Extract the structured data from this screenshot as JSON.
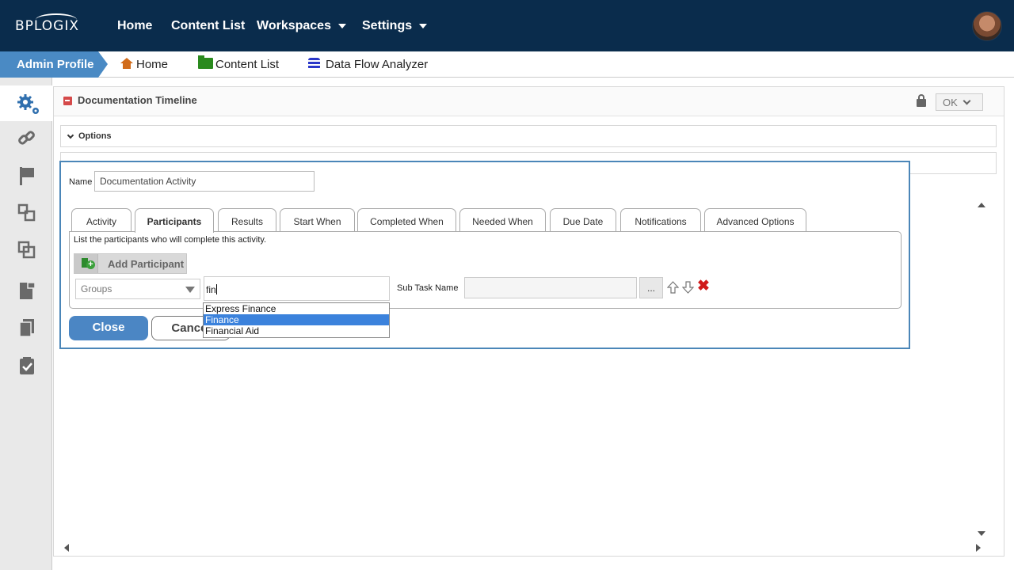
{
  "topbar": {
    "logo": "BPLOGIX",
    "nav": [
      {
        "label": "Home"
      },
      {
        "label": "Content List"
      },
      {
        "label": "Workspaces"
      },
      {
        "label": "Settings"
      }
    ]
  },
  "secondary_bar": {
    "profile": "Admin Profile",
    "links": [
      {
        "label": "Home",
        "icon": "home-icon"
      },
      {
        "label": "Content List",
        "icon": "folder-icon"
      },
      {
        "label": "Data Flow Analyzer",
        "icon": "database-icon"
      }
    ]
  },
  "sidebar": {
    "items": [
      "settings-gears-icon",
      "link-icon",
      "flag-icon",
      "subprocess-icon",
      "copy-frames-icon",
      "locked-document-icon",
      "documents-icon",
      "task-check-icon"
    ]
  },
  "main": {
    "title": "Documentation Timeline",
    "ok_label": "OK",
    "options_label": "Options"
  },
  "dialog": {
    "name_label": "Name",
    "name_value": "Documentation Activity",
    "tabs": [
      {
        "label": "Activity"
      },
      {
        "label": "Participants",
        "active": true
      },
      {
        "label": "Results"
      },
      {
        "label": "Start When"
      },
      {
        "label": "Completed When"
      },
      {
        "label": "Needed When"
      },
      {
        "label": "Due Date"
      },
      {
        "label": "Notifications"
      },
      {
        "label": "Advanced Options"
      }
    ],
    "panel_instruction": "List the participants who will complete this activity.",
    "add_participant_label": "Add Participant",
    "participant_type": "Groups",
    "participant_input_value": "fin",
    "sub_task_label": "Sub Task Name",
    "sub_task_value": "",
    "ellipsis_label": "...",
    "remove_glyph": "✖",
    "close_label": "Close",
    "cancel_label": "Cancel",
    "autocomplete": [
      {
        "label": "Express Finance",
        "selected": false
      },
      {
        "label": "Finance",
        "selected": true
      },
      {
        "label": "Financial Aid",
        "selected": false
      }
    ]
  },
  "colors": {
    "topbar": "#0a2c4c",
    "accent": "#4b86c4",
    "selected": "#3b82dc",
    "remove": "#d01a1a"
  }
}
